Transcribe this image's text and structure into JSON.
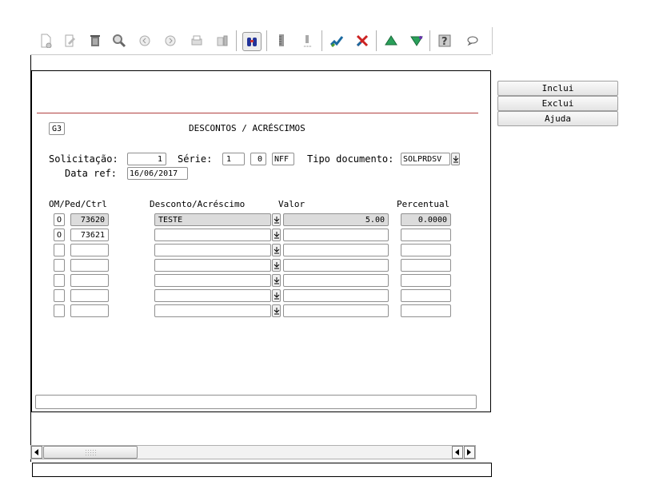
{
  "toolbar": {
    "icons": [
      "new-document-icon",
      "edit-icon",
      "delete-icon",
      "search-icon",
      "previous-icon",
      "next-icon",
      "print-icon",
      "print-setup-icon",
      "binoculars-icon",
      "ruler-icon",
      "ruler2-icon",
      "confirm-icon",
      "cancel-icon",
      "up-icon",
      "filter-icon",
      "help-icon",
      "comment-icon"
    ]
  },
  "side_buttons": {
    "inclui": "Inclui",
    "exclui": "Exclui",
    "ajuda": "Ajuda"
  },
  "form": {
    "code": "G3",
    "title": "DESCONTOS / ACRÉSCIMOS",
    "solicitacao_label": "Solicitação:",
    "solicitacao_value": "1",
    "serie_label": "Série:",
    "serie_value1": "1",
    "serie_value2": "0",
    "serie_value3": "NFF",
    "tipo_label": "Tipo documento:",
    "tipo_value": "SOLPRDSV",
    "data_label": "Data ref:",
    "data_value": "16/06/2017"
  },
  "grid": {
    "headers": {
      "om": "OM/Ped/Ctrl",
      "desc": "Desconto/Acréscimo",
      "valor": "Valor",
      "perc": "Percentual"
    },
    "rows": [
      {
        "type": "O",
        "num": "73620",
        "desc": "TESTE",
        "valor": "5.00",
        "perc": "0.0000"
      },
      {
        "type": "O",
        "num": "73621",
        "desc": "",
        "valor": "",
        "perc": ""
      },
      {
        "type": "",
        "num": "",
        "desc": "",
        "valor": "",
        "perc": ""
      },
      {
        "type": "",
        "num": "",
        "desc": "",
        "valor": "",
        "perc": ""
      },
      {
        "type": "",
        "num": "",
        "desc": "",
        "valor": "",
        "perc": ""
      },
      {
        "type": "",
        "num": "",
        "desc": "",
        "valor": "",
        "perc": ""
      },
      {
        "type": "",
        "num": "",
        "desc": "",
        "valor": "",
        "perc": ""
      }
    ]
  },
  "status_message": "",
  "bottom_status": ""
}
